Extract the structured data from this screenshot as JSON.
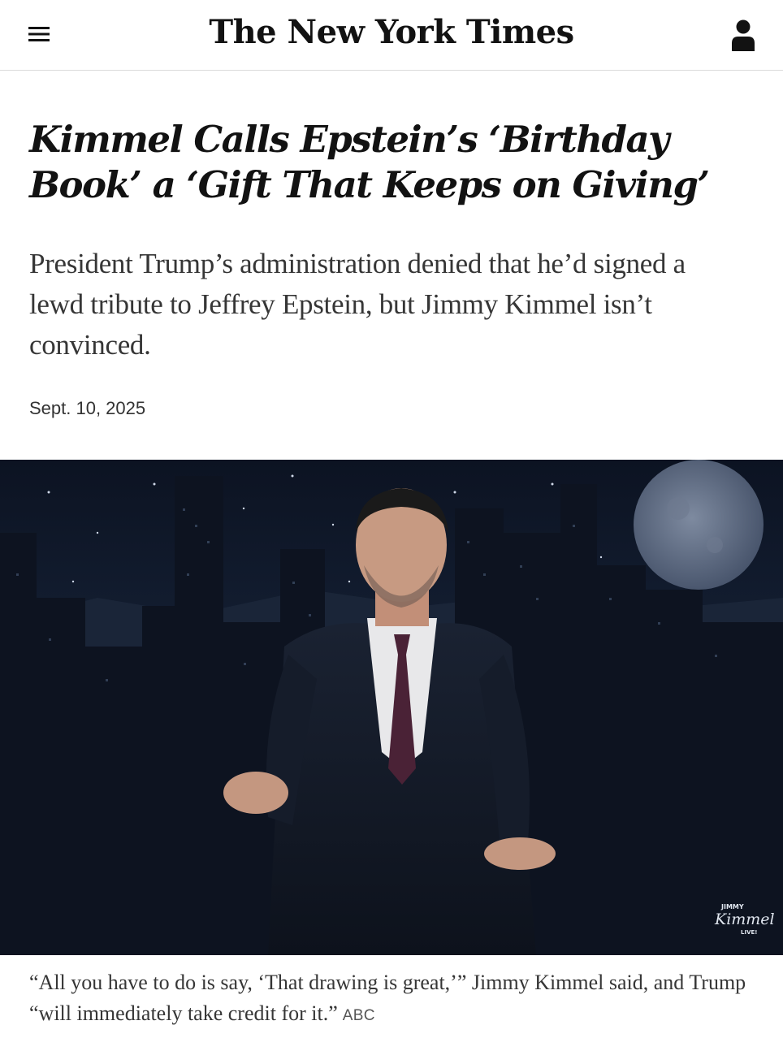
{
  "masthead": {
    "logo": "The New York Times",
    "menu_icon": "hamburger-menu-icon",
    "account_icon": "user-account-icon"
  },
  "article": {
    "headline": "Kimmel Calls Epstein’s ‘Birthday Book’ a ‘Gift That Keeps on Giving’",
    "summary": "President Trump’s administration denied that he’d signed a lewd tribute to Jeffrey Epstein, but Jimmy Kimmel isn’t convinced.",
    "date": "Sept. 10, 2025"
  },
  "photo": {
    "watermark_top": "JIMMY",
    "watermark_main": "Kimmel",
    "watermark_bottom": "LIVE!",
    "caption": "“All you have to do is say, ‘That drawing is great,’” Jimmy Kimmel said, and Trump “will immediately take credit for it.”",
    "credit": "ABC"
  }
}
